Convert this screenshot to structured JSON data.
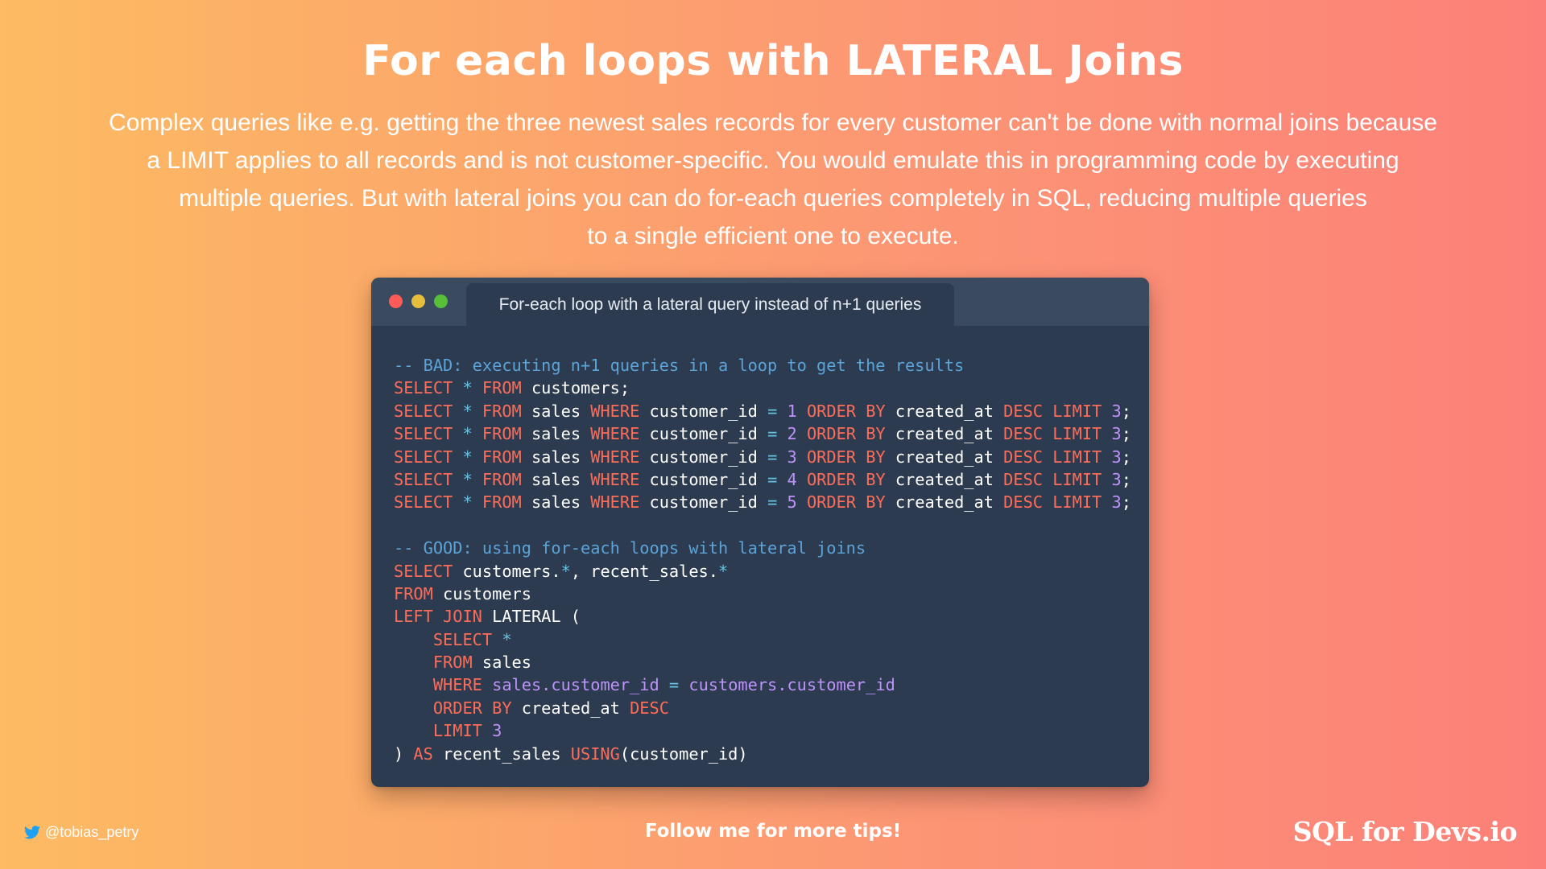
{
  "title": "For each loops with LATERAL Joins",
  "description_lines": [
    "Complex queries like e.g. getting the three newest sales records for every customer can't be done with normal joins because",
    "a LIMIT applies to all records and is not customer-specific. You would emulate this in programming code by executing",
    "multiple queries. But with lateral joins you can do for-each queries completely in SQL, reducing multiple queries",
    "to a single efficient one to execute."
  ],
  "window": {
    "tab_title": "For-each loop with a lateral query instead of n+1 queries",
    "traffic_lights": [
      "#fc5b57",
      "#e5bf3c",
      "#57c038"
    ],
    "code_colors": {
      "keyword": "#fc6d59",
      "comment": "#5ba3d8",
      "number": "#bd93f9",
      "operator": "#66c2e0",
      "plain": "#ffffff",
      "background": "#2d3b50"
    },
    "code_lines": [
      [
        {
          "t": "-- BAD: executing n+1 queries in a loop to get the results",
          "c": "c"
        }
      ],
      [
        {
          "t": "SELECT",
          "c": "k"
        },
        {
          "t": " "
        },
        {
          "t": "*",
          "c": "s"
        },
        {
          "t": " "
        },
        {
          "t": "FROM",
          "c": "k"
        },
        {
          "t": " customers;"
        }
      ],
      [
        {
          "t": "SELECT",
          "c": "k"
        },
        {
          "t": " "
        },
        {
          "t": "*",
          "c": "s"
        },
        {
          "t": " "
        },
        {
          "t": "FROM",
          "c": "k"
        },
        {
          "t": " sales "
        },
        {
          "t": "WHERE",
          "c": "k"
        },
        {
          "t": " customer_id "
        },
        {
          "t": "=",
          "c": "s"
        },
        {
          "t": " "
        },
        {
          "t": "1",
          "c": "n"
        },
        {
          "t": " "
        },
        {
          "t": "ORDER BY",
          "c": "k"
        },
        {
          "t": " created_at "
        },
        {
          "t": "DESC",
          "c": "k"
        },
        {
          "t": " "
        },
        {
          "t": "LIMIT",
          "c": "k"
        },
        {
          "t": " "
        },
        {
          "t": "3",
          "c": "n"
        },
        {
          "t": ";"
        }
      ],
      [
        {
          "t": "SELECT",
          "c": "k"
        },
        {
          "t": " "
        },
        {
          "t": "*",
          "c": "s"
        },
        {
          "t": " "
        },
        {
          "t": "FROM",
          "c": "k"
        },
        {
          "t": " sales "
        },
        {
          "t": "WHERE",
          "c": "k"
        },
        {
          "t": " customer_id "
        },
        {
          "t": "=",
          "c": "s"
        },
        {
          "t": " "
        },
        {
          "t": "2",
          "c": "n"
        },
        {
          "t": " "
        },
        {
          "t": "ORDER BY",
          "c": "k"
        },
        {
          "t": " created_at "
        },
        {
          "t": "DESC",
          "c": "k"
        },
        {
          "t": " "
        },
        {
          "t": "LIMIT",
          "c": "k"
        },
        {
          "t": " "
        },
        {
          "t": "3",
          "c": "n"
        },
        {
          "t": ";"
        }
      ],
      [
        {
          "t": "SELECT",
          "c": "k"
        },
        {
          "t": " "
        },
        {
          "t": "*",
          "c": "s"
        },
        {
          "t": " "
        },
        {
          "t": "FROM",
          "c": "k"
        },
        {
          "t": " sales "
        },
        {
          "t": "WHERE",
          "c": "k"
        },
        {
          "t": " customer_id "
        },
        {
          "t": "=",
          "c": "s"
        },
        {
          "t": " "
        },
        {
          "t": "3",
          "c": "n"
        },
        {
          "t": " "
        },
        {
          "t": "ORDER BY",
          "c": "k"
        },
        {
          "t": " created_at "
        },
        {
          "t": "DESC",
          "c": "k"
        },
        {
          "t": " "
        },
        {
          "t": "LIMIT",
          "c": "k"
        },
        {
          "t": " "
        },
        {
          "t": "3",
          "c": "n"
        },
        {
          "t": ";"
        }
      ],
      [
        {
          "t": "SELECT",
          "c": "k"
        },
        {
          "t": " "
        },
        {
          "t": "*",
          "c": "s"
        },
        {
          "t": " "
        },
        {
          "t": "FROM",
          "c": "k"
        },
        {
          "t": " sales "
        },
        {
          "t": "WHERE",
          "c": "k"
        },
        {
          "t": " customer_id "
        },
        {
          "t": "=",
          "c": "s"
        },
        {
          "t": " "
        },
        {
          "t": "4",
          "c": "n"
        },
        {
          "t": " "
        },
        {
          "t": "ORDER BY",
          "c": "k"
        },
        {
          "t": " created_at "
        },
        {
          "t": "DESC",
          "c": "k"
        },
        {
          "t": " "
        },
        {
          "t": "LIMIT",
          "c": "k"
        },
        {
          "t": " "
        },
        {
          "t": "3",
          "c": "n"
        },
        {
          "t": ";"
        }
      ],
      [
        {
          "t": "SELECT",
          "c": "k"
        },
        {
          "t": " "
        },
        {
          "t": "*",
          "c": "s"
        },
        {
          "t": " "
        },
        {
          "t": "FROM",
          "c": "k"
        },
        {
          "t": " sales "
        },
        {
          "t": "WHERE",
          "c": "k"
        },
        {
          "t": " customer_id "
        },
        {
          "t": "=",
          "c": "s"
        },
        {
          "t": " "
        },
        {
          "t": "5",
          "c": "n"
        },
        {
          "t": " "
        },
        {
          "t": "ORDER BY",
          "c": "k"
        },
        {
          "t": " created_at "
        },
        {
          "t": "DESC",
          "c": "k"
        },
        {
          "t": " "
        },
        {
          "t": "LIMIT",
          "c": "k"
        },
        {
          "t": " "
        },
        {
          "t": "3",
          "c": "n"
        },
        {
          "t": ";"
        }
      ],
      [],
      [
        {
          "t": "-- GOOD: using for-each loops with lateral joins",
          "c": "c"
        }
      ],
      [
        {
          "t": "SELECT",
          "c": "k"
        },
        {
          "t": " customers."
        },
        {
          "t": "*",
          "c": "s"
        },
        {
          "t": ", recent_sales."
        },
        {
          "t": "*",
          "c": "s"
        }
      ],
      [
        {
          "t": "FROM",
          "c": "k"
        },
        {
          "t": " customers"
        }
      ],
      [
        {
          "t": "LEFT JOIN",
          "c": "k"
        },
        {
          "t": " LATERAL ("
        }
      ],
      [
        {
          "t": "    "
        },
        {
          "t": "SELECT",
          "c": "k"
        },
        {
          "t": " "
        },
        {
          "t": "*",
          "c": "s"
        }
      ],
      [
        {
          "t": "    "
        },
        {
          "t": "FROM",
          "c": "k"
        },
        {
          "t": " sales"
        }
      ],
      [
        {
          "t": "    "
        },
        {
          "t": "WHERE",
          "c": "k"
        },
        {
          "t": " "
        },
        {
          "t": "sales.customer_id",
          "c": "n"
        },
        {
          "t": " "
        },
        {
          "t": "=",
          "c": "s"
        },
        {
          "t": " "
        },
        {
          "t": "customers.customer_id",
          "c": "n"
        }
      ],
      [
        {
          "t": "    "
        },
        {
          "t": "ORDER BY",
          "c": "k"
        },
        {
          "t": " created_at "
        },
        {
          "t": "DESC",
          "c": "k"
        }
      ],
      [
        {
          "t": "    "
        },
        {
          "t": "LIMIT",
          "c": "k"
        },
        {
          "t": " "
        },
        {
          "t": "3",
          "c": "n"
        }
      ],
      [
        {
          "t": ") "
        },
        {
          "t": "AS",
          "c": "k"
        },
        {
          "t": " recent_sales "
        },
        {
          "t": "USING",
          "c": "k"
        },
        {
          "t": "(customer_id)"
        }
      ]
    ]
  },
  "footer": {
    "handle_icon": "twitter-bird-icon",
    "handle": "@tobias_petry",
    "follow": "Follow me for more tips!",
    "brand": "SQL for Devs.io"
  },
  "colors": {
    "gradient_start": "#fdbb62",
    "gradient_end": "#fc8079",
    "twitter_blue": "#1da1f2"
  }
}
